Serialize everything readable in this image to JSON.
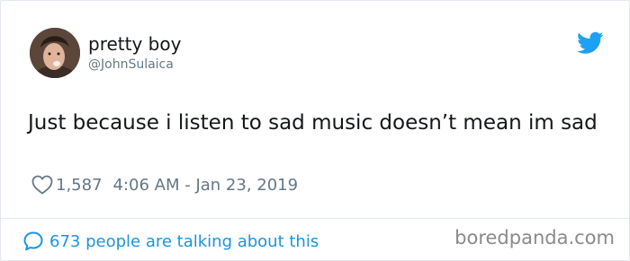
{
  "author": {
    "display_name": "pretty boy",
    "handle": "@JohnSulaica"
  },
  "tweet": {
    "text": "Just because i listen to sad music doesn’t mean im sad",
    "like_count": "1,587",
    "timestamp": "4:06 AM - Jan 23, 2019"
  },
  "footer": {
    "talking_text": "673 people are talking about this",
    "watermark": "boredpanda.com"
  },
  "icons": {
    "brand": "twitter-bird-icon",
    "like": "heart-icon",
    "reply": "speech-bubble-icon"
  },
  "colors": {
    "twitter_blue": "#1da1f2",
    "link_blue": "#1b95e0",
    "secondary_text": "#657786",
    "primary_text": "#14171a"
  }
}
